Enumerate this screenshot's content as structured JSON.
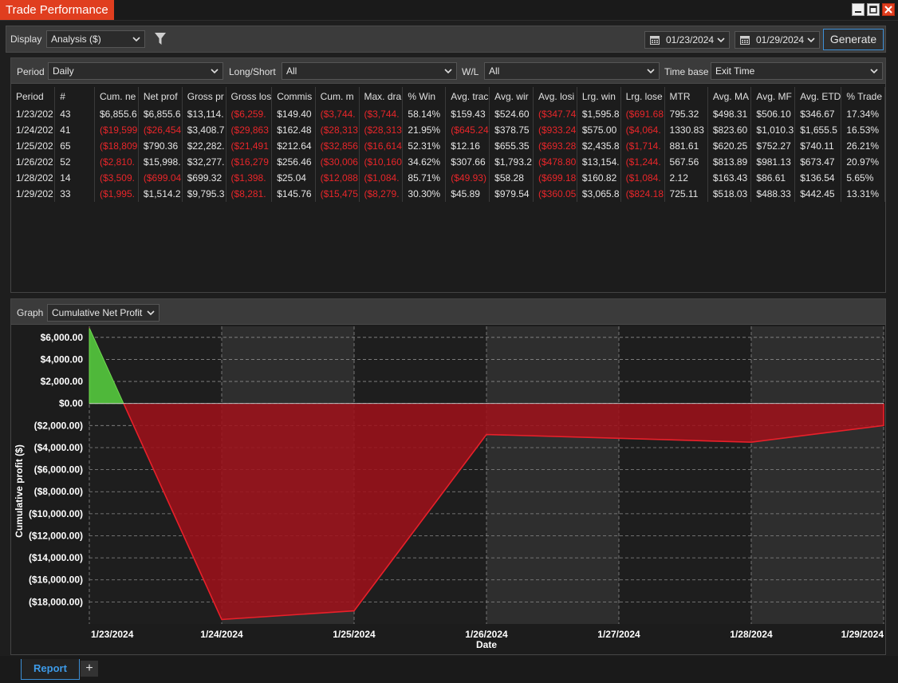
{
  "window": {
    "title": "Trade Performance"
  },
  "toolbar": {
    "display_label": "Display",
    "display_value": "Analysis ($)",
    "start_date": "01/23/2024",
    "end_date": "01/29/2024",
    "generate_label": "Generate"
  },
  "filters": {
    "period_label": "Period",
    "period_value": "Daily",
    "longshort_label": "Long/Short",
    "longshort_value": "All",
    "wl_label": "W/L",
    "wl_value": "All",
    "timebase_label": "Time base",
    "timebase_value": "Exit Time"
  },
  "table": {
    "headers": [
      "Period",
      "#",
      "Cum. ne",
      "Net prof",
      "Gross pr",
      "Gross los",
      "Commis",
      "Cum. m",
      "Max. dra",
      "% Win",
      "Avg. trac",
      "Avg. wir",
      "Avg. losi",
      "Lrg. win",
      "Lrg. lose",
      "MTR",
      "Avg. MA",
      "Avg. MF",
      "Avg. ETD",
      "% Trade"
    ],
    "rows": [
      [
        "1/23/202",
        "43",
        "$6,855.6",
        "$6,855.6",
        "$13,114.",
        "($6,259.",
        "$149.40",
        "($3,744.",
        "($3,744.",
        "58.14%",
        "$159.43",
        "$524.60",
        "($347.74",
        "$1,595.8",
        "($691.68",
        "795.32",
        "$498.31",
        "$506.10",
        "$346.67",
        "17.34%"
      ],
      [
        "1/24/202",
        "41",
        "($19,599",
        "($26,454",
        "$3,408.7",
        "($29,863",
        "$162.48",
        "($28,313",
        "($28,313",
        "21.95%",
        "($645.24",
        "$378.75",
        "($933.24",
        "$575.00",
        "($4,064.",
        "1330.83",
        "$823.60",
        "$1,010.3",
        "$1,655.5",
        "16.53%"
      ],
      [
        "1/25/202",
        "65",
        "($18,809",
        "$790.36",
        "$22,282.",
        "($21,491",
        "$212.64",
        "($32,856",
        "($16,614",
        "52.31%",
        "$12.16",
        "$655.35",
        "($693.28",
        "$2,435.8",
        "($1,714.",
        "881.61",
        "$620.25",
        "$752.27",
        "$740.11",
        "26.21%"
      ],
      [
        "1/26/202",
        "52",
        "($2,810.",
        "$15,998.",
        "$32,277.",
        "($16,279",
        "$256.46",
        "($30,006",
        "($10,160",
        "34.62%",
        "$307.66",
        "$1,793.2",
        "($478.80",
        "$13,154.",
        "($1,244.",
        "567.56",
        "$813.89",
        "$981.13",
        "$673.47",
        "20.97%"
      ],
      [
        "1/28/202",
        "14",
        "($3,509.",
        "($699.04",
        "$699.32",
        "($1,398.",
        "$25.04",
        "($12,088",
        "($1,084.",
        "85.71%",
        "($49.93)",
        "$58.28",
        "($699.18",
        "$160.82",
        "($1,084.",
        "2.12",
        "$163.43",
        "$86.61",
        "$136.54",
        "5.65%"
      ],
      [
        "1/29/202",
        "33",
        "($1,995.",
        "$1,514.2",
        "$9,795.3",
        "($8,281.",
        "$145.76",
        "($15,475",
        "($8,279.",
        "30.30%",
        "$45.89",
        "$979.54",
        "($360.05",
        "$3,065.8",
        "($824.18",
        "725.11",
        "$518.03",
        "$488.33",
        "$442.45",
        "13.31%"
      ]
    ]
  },
  "graph": {
    "label": "Graph",
    "value": "Cumulative Net Profit"
  },
  "chart_data": {
    "type": "area",
    "xlabel": "Date",
    "ylabel": "Cumulative profit ($)",
    "x": [
      "1/23/2024",
      "1/24/2024",
      "1/25/2024",
      "1/26/2024",
      "1/27/2024",
      "1/28/2024",
      "1/29/2024"
    ],
    "series": [
      {
        "values": [
          6855.6,
          -19599,
          -18809,
          -2810,
          -3160,
          -3509,
          -1995
        ]
      }
    ],
    "ylim": [
      -20000,
      7000
    ],
    "yticks": [
      6000,
      4000,
      2000,
      0,
      -2000,
      -4000,
      -6000,
      -8000,
      -10000,
      -12000,
      -14000,
      -16000,
      -18000
    ],
    "ytick_labels": [
      "$6,000.00",
      "$4,000.00",
      "$2,000.00",
      "$0.00",
      "($2,000.00)",
      "($4,000.00)",
      "($6,000.00)",
      "($8,000.00)",
      "($10,000.00)",
      "($12,000.00)",
      "($14,000.00)",
      "($16,000.00)",
      "($18,000.00)"
    ],
    "grid": true,
    "colors": {
      "positive": "#4fb83a",
      "negative": "#a0101a",
      "negative_line": "#e8202a"
    }
  },
  "tabs": {
    "report_label": "Report",
    "add_label": "+"
  }
}
